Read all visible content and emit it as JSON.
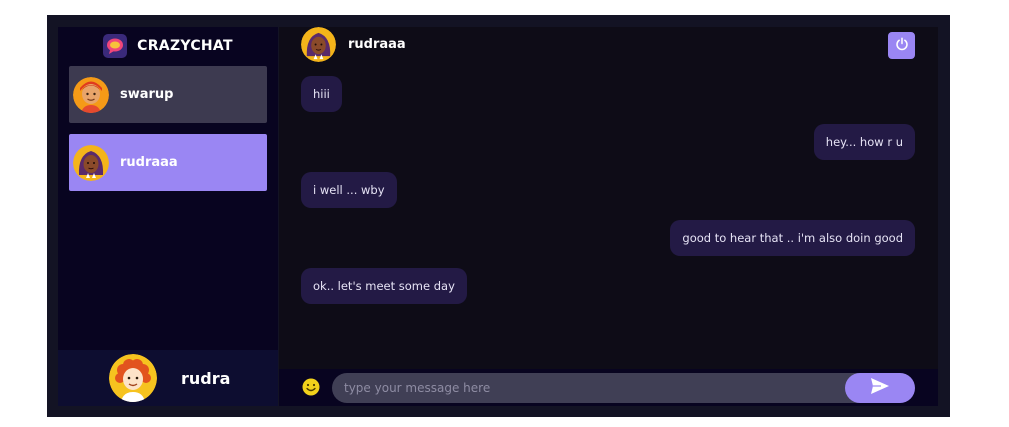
{
  "app": {
    "brand": "CRAZYCHAT"
  },
  "contacts": [
    {
      "name": "swarup",
      "avatar": "orange-cartoon-avatar",
      "selected": false
    },
    {
      "name": "rudraaa",
      "avatar": "purple-haired-avatar",
      "selected": true
    }
  ],
  "current_user": {
    "name": "rudra",
    "avatar": "curly-red-hair-avatar"
  },
  "chat": {
    "header_name": "rudraaa",
    "messages": [
      {
        "text": "hiii",
        "sender": "received"
      },
      {
        "text": "hey... how r u",
        "sender": "sent"
      },
      {
        "text": "i well ... wby",
        "sender": "received"
      },
      {
        "text": "good to hear that .. i'm also doin good",
        "sender": "sent"
      },
      {
        "text": "ok.. let's meet some day",
        "sender": "received"
      }
    ]
  },
  "input": {
    "placeholder": "type your message here",
    "value": ""
  },
  "icons": {
    "logout": "power-icon",
    "emoji": "emoji-icon",
    "send": "send-icon",
    "logo": "chat-bubble-logo-icon"
  },
  "colors": {
    "accent": "#9a86f3",
    "sidebar_bg": "#080420",
    "chat_bg": "#0e0c17",
    "bubble": "#231a45",
    "selected_contact": "#9a86f3",
    "contact": "#3d3a50"
  }
}
